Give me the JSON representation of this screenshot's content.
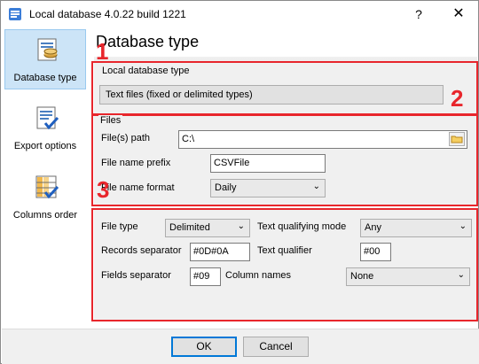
{
  "window": {
    "title": "Local database 4.0.22 build 1221",
    "help_label": "?",
    "close_label": "✕"
  },
  "sidebar": {
    "items": [
      {
        "label": "Database type",
        "icon": "database-icon",
        "active": true
      },
      {
        "label": "Export options",
        "icon": "export-options-icon",
        "active": false
      },
      {
        "label": "Columns order",
        "icon": "columns-order-icon",
        "active": false
      }
    ]
  },
  "main": {
    "title": "Database type",
    "markers": [
      "1",
      "2",
      "3"
    ],
    "section1": {
      "group_label": "Local database type",
      "db_type_value": "Text files (fixed or delimited types)"
    },
    "section2": {
      "group_label": "Files",
      "path_label": "File(s) path",
      "path_value": "C:\\",
      "prefix_label": "File name prefix",
      "prefix_value": "CSVFile",
      "format_label": "File name format",
      "format_value": "Daily"
    },
    "section3": {
      "file_type_label": "File type",
      "file_type_value": "Delimited",
      "text_qual_mode_label": "Text qualifying mode",
      "text_qual_mode_value": "Any",
      "records_sep_label": "Records separator",
      "records_sep_value": "#0D#0A",
      "text_qualifier_label": "Text qualifier",
      "text_qualifier_value": "#00",
      "fields_sep_label": "Fields separator",
      "fields_sep_value": "#09",
      "column_names_label": "Column names",
      "column_names_value": "None"
    }
  },
  "footer": {
    "ok_label": "OK",
    "cancel_label": "Cancel"
  },
  "colors": {
    "marker_red": "#e8262c",
    "active_nav": "#cce4f7",
    "panel_bg": "#f0f0f0"
  }
}
